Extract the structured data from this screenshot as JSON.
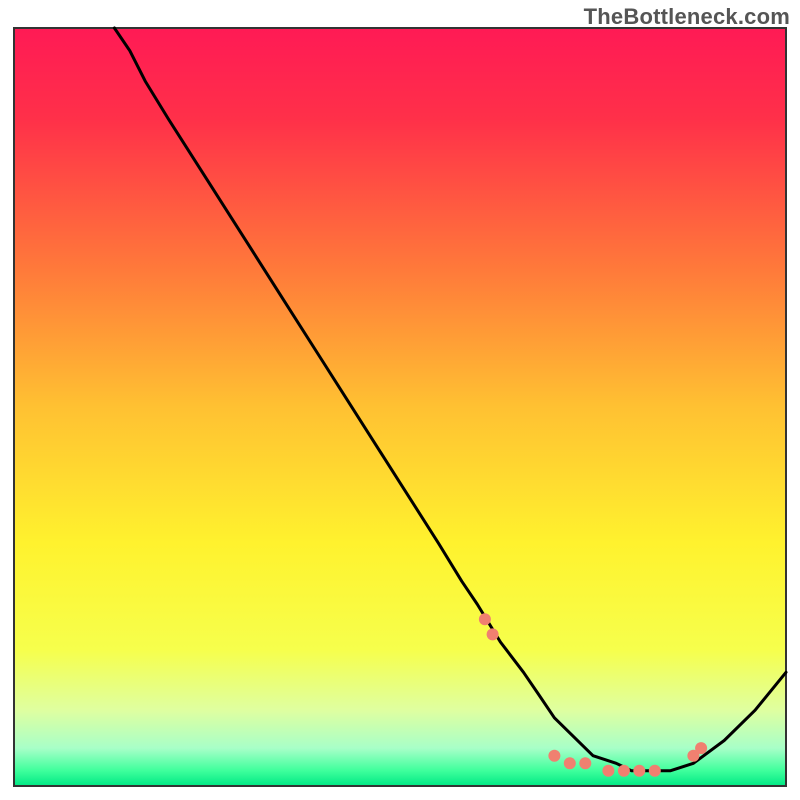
{
  "watermark": "TheBottleneck.com",
  "chart_data": {
    "type": "line",
    "title": "",
    "xlabel": "",
    "ylabel": "",
    "xlim": [
      0,
      100
    ],
    "ylim": [
      0,
      100
    ],
    "series": [
      {
        "name": "curve",
        "color": "#000000",
        "x": [
          13,
          15,
          17,
          20,
          25,
          30,
          35,
          40,
          45,
          50,
          55,
          58,
          60,
          63,
          66,
          68,
          70,
          72,
          75,
          78,
          80,
          82,
          85,
          88,
          92,
          96,
          100
        ],
        "y": [
          100,
          97,
          93,
          88,
          80,
          72,
          64,
          56,
          48,
          40,
          32,
          27,
          24,
          19,
          15,
          12,
          9,
          7,
          4,
          3,
          2,
          2,
          2,
          3,
          6,
          10,
          15
        ]
      }
    ],
    "markers": {
      "name": "dots",
      "color": "#f08070",
      "radius": 6,
      "x": [
        61,
        62,
        70,
        72,
        74,
        77,
        79,
        81,
        83,
        88,
        89
      ],
      "y": [
        22,
        20,
        4,
        3,
        3,
        2,
        2,
        2,
        2,
        4,
        5
      ]
    },
    "gradient_stops": [
      {
        "offset": 0.0,
        "color": "#ff1a55"
      },
      {
        "offset": 0.12,
        "color": "#ff3049"
      },
      {
        "offset": 0.32,
        "color": "#ff7a3a"
      },
      {
        "offset": 0.5,
        "color": "#ffc132"
      },
      {
        "offset": 0.68,
        "color": "#fff22e"
      },
      {
        "offset": 0.82,
        "color": "#f6ff4c"
      },
      {
        "offset": 0.9,
        "color": "#dfffa0"
      },
      {
        "offset": 0.95,
        "color": "#a8ffc8"
      },
      {
        "offset": 0.98,
        "color": "#3eff9c"
      },
      {
        "offset": 1.0,
        "color": "#00e884"
      }
    ],
    "frame": {
      "inset_top": 28,
      "inset_left": 14,
      "inset_right": 14,
      "inset_bottom": 14,
      "stroke": "#333333",
      "stroke_width": 2
    }
  }
}
